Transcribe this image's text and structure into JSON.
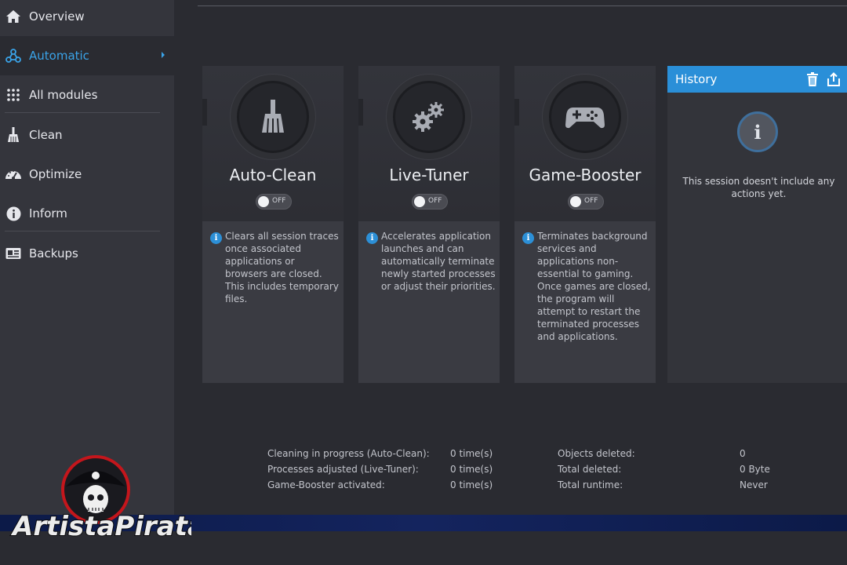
{
  "sidebar": {
    "items": [
      {
        "label": "Overview",
        "icon": "home-icon"
      },
      {
        "label": "Automatic",
        "icon": "network-icon",
        "active": true
      },
      {
        "label": "All modules",
        "icon": "grid-icon"
      },
      {
        "label": "Clean",
        "icon": "broom-icon"
      },
      {
        "label": "Optimize",
        "icon": "gauge-icon"
      },
      {
        "label": "Inform",
        "icon": "info-icon"
      },
      {
        "label": "Backups",
        "icon": "backup-icon"
      }
    ]
  },
  "cards": [
    {
      "title": "Auto-Clean",
      "toggle": "OFF",
      "icon": "broom-icon",
      "description": "Clears all session traces once associated applications or browsers are closed. This includes temporary files."
    },
    {
      "title": "Live-Tuner",
      "toggle": "OFF",
      "icon": "gears-icon",
      "description": "Accelerates application launches and can automatically terminate newly started processes or adjust their priorities."
    },
    {
      "title": "Game-Booster",
      "toggle": "OFF",
      "icon": "gamepad-icon",
      "description": "Terminates background services and applications non-essential to gaming. Once games are closed, the program will attempt to restart the terminated processes and applications."
    }
  ],
  "history": {
    "title": "History",
    "empty_text": "This session doesn't include any actions yet."
  },
  "stats": {
    "left": [
      {
        "label": "Cleaning in progress (Auto-Clean):",
        "value": "0 time(s)"
      },
      {
        "label": "Processes adjusted (Live-Tuner):",
        "value": "0 time(s)"
      },
      {
        "label": "Game-Booster activated:",
        "value": "0 time(s)"
      }
    ],
    "right": [
      {
        "label": "Objects deleted:",
        "value": "0"
      },
      {
        "label": "Total deleted:",
        "value": "0 Byte"
      },
      {
        "label": "Total runtime:",
        "value": "Never"
      }
    ]
  },
  "watermark": {
    "text": "ArtistaPirata"
  },
  "colors": {
    "accent": "#2a8fd8",
    "active_text": "#3aa3e8",
    "sidebar_bg": "#34353c",
    "main_bg": "#2a2b31"
  }
}
